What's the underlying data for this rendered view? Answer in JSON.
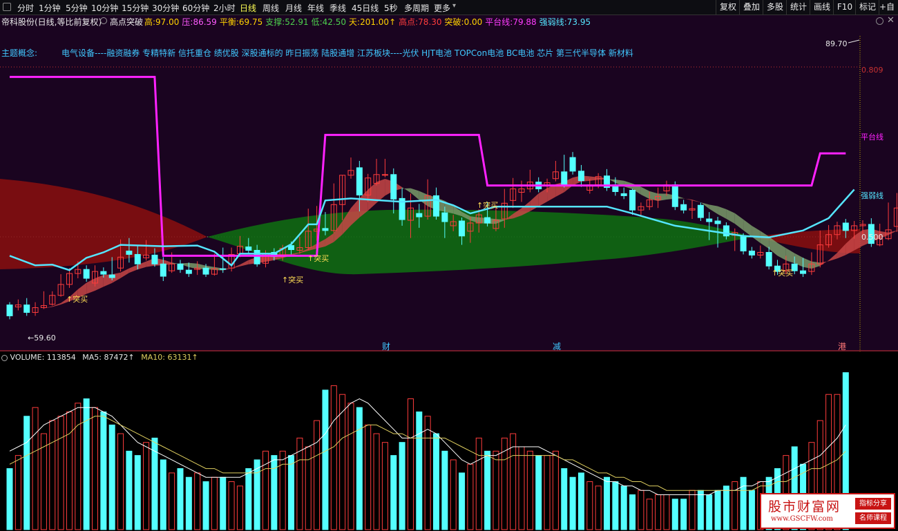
{
  "toolbar": {
    "periods": [
      "分时",
      "1分钟",
      "5分钟",
      "10分钟",
      "15分钟",
      "30分钟",
      "60分钟",
      "2小时",
      "日线",
      "周线",
      "月线",
      "年线",
      "季线",
      "45日线",
      "5秒",
      "多周期",
      "更多"
    ],
    "active_period": "日线",
    "right_buttons": [
      "复权",
      "叠加",
      "多股",
      "统计",
      "画线",
      "F10",
      "标记"
    ],
    "extra": "+自选"
  },
  "info_bar": {
    "title": "帝科股份(日线,等比前复权)",
    "indicator_name": "高点突破",
    "values": [
      {
        "label": "高:",
        "value": "97.00",
        "color": "#ffd200"
      },
      {
        "label": "压:",
        "value": "86.59",
        "color": "#ff5aff"
      },
      {
        "label": "平衡:",
        "value": "69.75",
        "color": "#ffd200"
      },
      {
        "label": "支撑:",
        "value": "52.91",
        "color": "#4dd04d"
      },
      {
        "label": "低:",
        "value": "42.50",
        "color": "#4dd04d"
      },
      {
        "label": "天:",
        "value": "201.00↑",
        "color": "#ffd200"
      },
      {
        "label": "高点:",
        "value": "78.30",
        "color": "#ff3c3c"
      },
      {
        "label": "突破:",
        "value": "0.00",
        "color": "#ffd200"
      },
      {
        "label": "平台线:",
        "value": "79.88",
        "color": "#ff3cff"
      },
      {
        "label": "强弱线:",
        "value": "73.95",
        "color": "#55e6ff"
      }
    ]
  },
  "concepts": {
    "label": "主题概念:",
    "text": "电气设备----融资融券 专精特新 信托重仓 绩优股 深股通标的 昨日振荡 陆股通增 江苏板块----光伏 HJT电池 TOPCon电池 BC电池 芯片 第三代半导体 新材料"
  },
  "price_labels": {
    "high_mark": "89.70",
    "right_top": "0.809",
    "right_mid": "0.500",
    "low_mark": "59.60",
    "platform_label": "平台线",
    "strength_label": "强弱线",
    "breakout_label": "突买"
  },
  "event_markers": [
    "财",
    "减",
    "港"
  ],
  "volume_header": {
    "label": "VOLUME:",
    "value": "113854",
    "ma5_label": "MA5:",
    "ma5_value": "87472↑",
    "ma10_label": "MA10:",
    "ma10_value": "63131↑"
  },
  "watermark": {
    "title": "股市财富网",
    "url": "www.GSCFW.com",
    "tag1": "指标分享",
    "tag2": "名师课程"
  },
  "colors": {
    "up": "#ff3c3c",
    "down": "#54ffff",
    "platform": "#ff22ff",
    "strength": "#55e6ff",
    "band_red": "#8b0f0f",
    "band_green": "#0f6a12",
    "ma5": "#ffffff",
    "ma10": "#e0d060"
  },
  "chart_data": [
    {
      "type": "candlestick",
      "title": "帝科股份(日线,等比前复权)",
      "y_axis_labels": [
        "0.809",
        "0.500"
      ],
      "annotations": [
        "89.70",
        "59.60",
        "平台线",
        "强弱线",
        "突买"
      ],
      "candles": [
        [
          63.6,
          62.0,
          64.0,
          61.5
        ],
        [
          63.3,
          63.6,
          64.4,
          62.8
        ],
        [
          63.6,
          62.5,
          64.6,
          62.0
        ],
        [
          62.5,
          63.2,
          64.0,
          62.0
        ],
        [
          63.2,
          63.5,
          65.6,
          63.0
        ],
        [
          63.7,
          65.0,
          65.6,
          63.5
        ],
        [
          65.0,
          66.6,
          68.1,
          64.8
        ],
        [
          66.6,
          68.2,
          69.0,
          66.1
        ],
        [
          68.2,
          68.8,
          70.0,
          67.5
        ],
        [
          68.8,
          67.5,
          69.4,
          67.0
        ],
        [
          66.8,
          68.5,
          69.4,
          66.3
        ],
        [
          68.5,
          68.1,
          69.1,
          67.6
        ],
        [
          68.0,
          67.6,
          70.6,
          67.2
        ],
        [
          69.0,
          70.6,
          73.2,
          68.5
        ],
        [
          71.5,
          71.0,
          73.4,
          69.8
        ],
        [
          71.0,
          69.6,
          72.4,
          68.8
        ],
        [
          70.5,
          70.9,
          73.1,
          70.1
        ],
        [
          70.9,
          69.6,
          71.9,
          69.2
        ],
        [
          69.6,
          67.8,
          70.6,
          67.1
        ],
        [
          68.6,
          69.6,
          71.3,
          68.3
        ],
        [
          69.6,
          68.8,
          70.2,
          68.3
        ],
        [
          68.7,
          68.2,
          69.8,
          67.7
        ],
        [
          68.8,
          69.0,
          70.0,
          68.0
        ],
        [
          69.0,
          68.1,
          69.6,
          67.7
        ],
        [
          68.1,
          68.9,
          71.1,
          67.9
        ],
        [
          68.9,
          68.8,
          72.0,
          68.3
        ],
        [
          69.0,
          71.0,
          72.0,
          68.5
        ],
        [
          71.1,
          72.2,
          73.7,
          70.6
        ],
        [
          72.1,
          71.6,
          73.4,
          71.0
        ],
        [
          71.6,
          69.6,
          72.4,
          69.2
        ],
        [
          69.7,
          71.1,
          71.6,
          69.1
        ],
        [
          71.3,
          70.7,
          71.9,
          70.1
        ],
        [
          70.7,
          71.9,
          72.4,
          70.1
        ],
        [
          72.3,
          71.7,
          72.9,
          71.0
        ],
        [
          71.6,
          72.0,
          73.6,
          71.1
        ],
        [
          72.0,
          74.4,
          77.7,
          71.6
        ],
        [
          74.4,
          74.7,
          78.1,
          73.0
        ],
        [
          74.8,
          74.5,
          77.2,
          73.8
        ],
        [
          74.5,
          78.3,
          81.4,
          74.1
        ],
        [
          78.3,
          82.6,
          82.6,
          76.0
        ],
        [
          82.6,
          83.3,
          85.2,
          82.1
        ],
        [
          83.7,
          79.7,
          84.7,
          77.3
        ],
        [
          79.7,
          82.2,
          82.8,
          78.7
        ],
        [
          81.4,
          82.7,
          85.0,
          81.1
        ],
        [
          82.7,
          82.7,
          85.0,
          82.3
        ],
        [
          82.7,
          79.1,
          83.6,
          77.0
        ],
        [
          79.2,
          76.1,
          80.7,
          75.2
        ],
        [
          76.0,
          77.8,
          79.9,
          73.4
        ],
        [
          77.0,
          76.5,
          78.4,
          74.9
        ],
        [
          76.6,
          79.6,
          82.0,
          76.1
        ],
        [
          79.6,
          76.6,
          80.8,
          76.1
        ],
        [
          77.1,
          75.8,
          78.0,
          73.4
        ],
        [
          75.2,
          75.8,
          76.8,
          74.4
        ],
        [
          75.9,
          73.7,
          76.4,
          72.4
        ],
        [
          74.4,
          75.6,
          76.5,
          72.7
        ],
        [
          75.6,
          76.8,
          77.6,
          74.2
        ],
        [
          76.4,
          75.6,
          78.7,
          75.1
        ],
        [
          74.8,
          76.0,
          78.2,
          74.4
        ],
        [
          76.2,
          78.5,
          80.6,
          74.9
        ],
        [
          78.9,
          80.6,
          82.2,
          77.8
        ],
        [
          80.1,
          80.6,
          81.8,
          78.7
        ],
        [
          80.6,
          81.6,
          83.4,
          80.1
        ],
        [
          81.6,
          80.6,
          82.3,
          80.1
        ],
        [
          81.1,
          81.5,
          82.1,
          80.1
        ],
        [
          82.1,
          83.1,
          84.7,
          81.7
        ],
        [
          83.1,
          81.1,
          85.6,
          80.8
        ],
        [
          85.2,
          83.2,
          86.0,
          82.7
        ],
        [
          83.2,
          81.8,
          84.1,
          80.9
        ],
        [
          80.4,
          81.2,
          82.1,
          79.9
        ],
        [
          81.2,
          82.4,
          82.9,
          80.7
        ],
        [
          82.5,
          80.8,
          83.5,
          80.3
        ],
        [
          81.2,
          80.2,
          82.3,
          79.6
        ],
        [
          79.9,
          79.6,
          80.8,
          79.1
        ],
        [
          80.4,
          77.5,
          80.6,
          76.8
        ],
        [
          77.5,
          78.0,
          78.6,
          76.5
        ],
        [
          78.0,
          79.0,
          80.2,
          77.5
        ],
        [
          79.0,
          79.5,
          80.8,
          77.8
        ],
        [
          80.3,
          81.2,
          81.8,
          79.6
        ],
        [
          81.2,
          78.0,
          81.7,
          77.5
        ],
        [
          78.3,
          77.5,
          79.0,
          77.0
        ],
        [
          77.5,
          77.7,
          78.9,
          76.2
        ],
        [
          78.2,
          76.4,
          78.6,
          75.9
        ],
        [
          76.2,
          75.8,
          77.2,
          73.1
        ],
        [
          75.9,
          75.5,
          76.5,
          72.0
        ],
        [
          75.2,
          73.7,
          75.7,
          73.2
        ],
        [
          73.8,
          74.2,
          74.8,
          71.5
        ],
        [
          73.6,
          71.5,
          74.1,
          71.0
        ],
        [
          71.5,
          70.9,
          72.1,
          70.4
        ],
        [
          70.9,
          71.3,
          72.3,
          70.4
        ],
        [
          71.3,
          69.3,
          72.1,
          68.8
        ],
        [
          69.3,
          68.5,
          70.2,
          68.0
        ],
        [
          68.6,
          69.6,
          70.8,
          68.1
        ],
        [
          69.6,
          68.6,
          70.7,
          68.1
        ],
        [
          68.6,
          68.2,
          70.5,
          67.7
        ],
        [
          68.5,
          69.6,
          71.3,
          68.0
        ],
        [
          69.6,
          72.4,
          74.5,
          69.1
        ],
        [
          72.4,
          73.9,
          75.3,
          72.0
        ],
        [
          73.9,
          75.2,
          75.8,
          73.2
        ],
        [
          75.6,
          74.5,
          76.2,
          73.4
        ],
        [
          74.5,
          75.2,
          75.9,
          73.3
        ],
        [
          75.2,
          75.4,
          76.0,
          73.6
        ],
        [
          75.4,
          72.6,
          76.3,
          72.1
        ],
        [
          72.4,
          73.3,
          75.5,
          72.2
        ],
        [
          73.3,
          74.6,
          78.6,
          73.1
        ],
        [
          75.1,
          77.8,
          80.0,
          74.3
        ],
        [
          77.6,
          76.7,
          79.6,
          76.4
        ],
        [
          77.4,
          78.6,
          80.0,
          77.1
        ],
        [
          78.6,
          77.7,
          80.3,
          77.2
        ],
        [
          77.7,
          76.6,
          78.3,
          76.1
        ],
        [
          76.6,
          77.9,
          78.4,
          76.1
        ],
        [
          77.9,
          76.8,
          78.5,
          76.3
        ],
        [
          76.8,
          77.0,
          79.4,
          76.3
        ],
        [
          77.2,
          79.6,
          82.6,
          76.9
        ],
        [
          79.6,
          77.6,
          80.2,
          77.1
        ],
        [
          77.6,
          79.6,
          81.8,
          77.1
        ],
        [
          80.2,
          84.0,
          85.0,
          79.7
        ],
        [
          84.0,
          88.0,
          90.3,
          83.5
        ],
        [
          88.0,
          89.0,
          90.3,
          86.6
        ],
        [
          88.8,
          93.6,
          93.9,
          85.5
        ]
      ],
      "platform_line": [
        [
          0,
          97.0
        ],
        [
          17,
          97.0
        ],
        [
          18,
          70.8
        ],
        [
          36,
          70.8
        ],
        [
          37,
          88.5
        ],
        [
          55,
          88.5
        ],
        [
          56,
          81.1
        ],
        [
          94,
          81.1
        ],
        [
          95,
          85.8
        ],
        [
          98,
          85.8
        ]
      ],
      "strength_line": [
        [
          0,
          70.8
        ],
        [
          3,
          69.4
        ],
        [
          5,
          69.5
        ],
        [
          7,
          68.7
        ],
        [
          9,
          70.5
        ],
        [
          11,
          71.3
        ],
        [
          13,
          72.4
        ],
        [
          18,
          72.2
        ],
        [
          22,
          72.3
        ],
        [
          24,
          71.4
        ],
        [
          26,
          69.4
        ],
        [
          27,
          71.1
        ],
        [
          31,
          71.1
        ],
        [
          33,
          72.5
        ],
        [
          35,
          75.4
        ],
        [
          36,
          75.4
        ],
        [
          37,
          78.9
        ],
        [
          40,
          79.2
        ],
        [
          46,
          78.7
        ],
        [
          50,
          79.0
        ],
        [
          52,
          78.2
        ],
        [
          54,
          77.0
        ],
        [
          57,
          78.0
        ],
        [
          70,
          78.0
        ],
        [
          73,
          77.0
        ],
        [
          78,
          75.2
        ],
        [
          86,
          73.7
        ],
        [
          89,
          73.5
        ],
        [
          93,
          74.5
        ],
        [
          96,
          76.3
        ],
        [
          99,
          80.5
        ]
      ],
      "volume": [
        14,
        17,
        26,
        28,
        22,
        25,
        26,
        27,
        29,
        30,
        28,
        27,
        24,
        22,
        18,
        17,
        20,
        21,
        16,
        13,
        14,
        12,
        13,
        11,
        12,
        12,
        11,
        10,
        14,
        16,
        18,
        17,
        18,
        17,
        21,
        19,
        25,
        32,
        33,
        31,
        29,
        28,
        24,
        22,
        20,
        17,
        20,
        30,
        27,
        26,
        22,
        18,
        16,
        13,
        15,
        21,
        18,
        18,
        21,
        22,
        19,
        18,
        17,
        17,
        18,
        14,
        12,
        13,
        11,
        10,
        12,
        11,
        10,
        8,
        9,
        7,
        8,
        8,
        7,
        7,
        9,
        9,
        8,
        9,
        10,
        11,
        12,
        9,
        11,
        12,
        14,
        17,
        19,
        15,
        20,
        25,
        31,
        31,
        36
      ],
      "volume_ma5": [
        18,
        19,
        20,
        22,
        24,
        25,
        26,
        27,
        28,
        28,
        28,
        27,
        26,
        24,
        22,
        20,
        19,
        18,
        17,
        16,
        15,
        14,
        13,
        12,
        12,
        12,
        12,
        12,
        13,
        14,
        15,
        16,
        16,
        17,
        18,
        19,
        20,
        22,
        25,
        27,
        29,
        30,
        29,
        27,
        25,
        23,
        21,
        21,
        22,
        23,
        22,
        20,
        18,
        16,
        15,
        16,
        17,
        17,
        18,
        19,
        19,
        19,
        19,
        18,
        17,
        16,
        15,
        14,
        13,
        12,
        11,
        11,
        10,
        10,
        9,
        9,
        8,
        8,
        8,
        8,
        8,
        8,
        8,
        9,
        9,
        9,
        10,
        10,
        11,
        11,
        12,
        13,
        14,
        15,
        16,
        17,
        19,
        21,
        24
      ],
      "volume_ma10": [
        15,
        16,
        17,
        18,
        19,
        20,
        21,
        22,
        24,
        25,
        26,
        26,
        25,
        24,
        23,
        22,
        21,
        20,
        19,
        18,
        17,
        16,
        15,
        14,
        14,
        13,
        13,
        13,
        13,
        13,
        14,
        14,
        15,
        15,
        16,
        16,
        17,
        18,
        19,
        21,
        22,
        23,
        24,
        24,
        23,
        22,
        22,
        21,
        21,
        21,
        21,
        21,
        20,
        19,
        18,
        17,
        17,
        16,
        16,
        17,
        17,
        17,
        17,
        17,
        17,
        16,
        16,
        15,
        14,
        13,
        13,
        12,
        12,
        11,
        11,
        10,
        10,
        9,
        9,
        9,
        9,
        9,
        9,
        9,
        9,
        9,
        9,
        9,
        10,
        10,
        11,
        11,
        12,
        13,
        14,
        14,
        15,
        16,
        18
      ],
      "ylim": [
        58.5,
        102
      ],
      "volume_ylim": [
        0,
        38
      ]
    }
  ]
}
